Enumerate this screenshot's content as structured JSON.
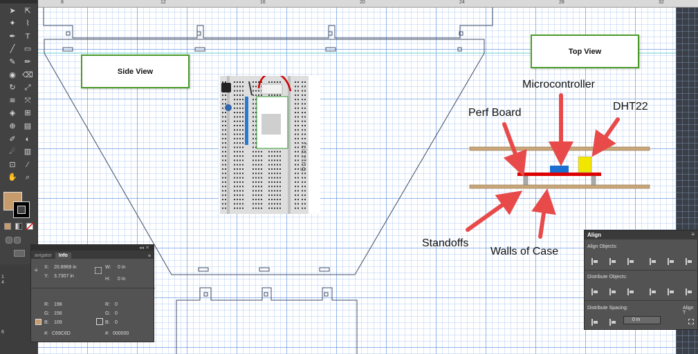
{
  "ruler": {
    "numbers": [
      "8",
      "12",
      "16",
      "20",
      "24",
      "28",
      "32"
    ]
  },
  "vruler": {
    "numbers": [
      "1",
      "4",
      "6"
    ]
  },
  "toolbar": {
    "tools": [
      "selection-tool",
      "direct-selection-tool",
      "magic-wand-tool",
      "lasso-tool",
      "pen-tool",
      "type-tool",
      "line-tool",
      "rectangle-tool",
      "paintbrush-tool",
      "pencil-tool",
      "blob-brush-tool",
      "eraser-tool",
      "rotate-tool",
      "scale-tool",
      "width-tool",
      "free-transform-tool",
      "shape-builder-tool",
      "perspective-grid-tool",
      "mesh-tool",
      "gradient-tool",
      "eyedropper-tool",
      "blend-tool",
      "symbol-sprayer-tool",
      "column-graph-tool",
      "artboard-tool",
      "slice-tool",
      "hand-tool",
      "zoom-tool"
    ],
    "fill_color": "#C69C6D",
    "stroke_color": "#000000"
  },
  "canvas": {
    "side_view_label": "Side View",
    "top_view_label": "Top View",
    "annotations": {
      "microcontroller": "Microcontroller",
      "perf_board": "Perf Board",
      "dht22": "DHT22",
      "standoffs": "Standoffs",
      "walls_of_case": "Walls of Case"
    },
    "breadboard_brand": "fritzing",
    "colors": {
      "outline": "#3c4a66",
      "box_border": "#4a9a2a",
      "arrow": "#e84a4a",
      "board": "#c8a87a",
      "perf": "#dd0000",
      "mcu": "#1a6fd0",
      "sensor": "#f2e600",
      "standoff": "#aaaaaa"
    }
  },
  "info_panel": {
    "tab_navigator": "avigator",
    "tab_info": "Info",
    "x_label": "X:",
    "x_value": "20.8969 in",
    "y_label": "Y:",
    "y_value": "3.7307 in",
    "w_label": "W:",
    "w_value": "0 in",
    "h_label": "H:",
    "h_value": "0 in",
    "fill": {
      "r_label": "R:",
      "r": "198",
      "g_label": "G:",
      "g": "156",
      "b_label": "B:",
      "b": "109",
      "hex_label": "#:",
      "hex": "C69C6D"
    },
    "stroke": {
      "r_label": "R:",
      "r": "0",
      "g_label": "G:",
      "g": "0",
      "b_label": "B:",
      "b": "0",
      "hex_label": "#:",
      "hex": "000000"
    }
  },
  "align_panel": {
    "title": "Align",
    "align_objects": "Align Objects:",
    "distribute_objects": "Distribute Objects:",
    "distribute_spacing": "Distribute Spacing:",
    "align_to": "Align T",
    "spacing_value": "0 in"
  }
}
